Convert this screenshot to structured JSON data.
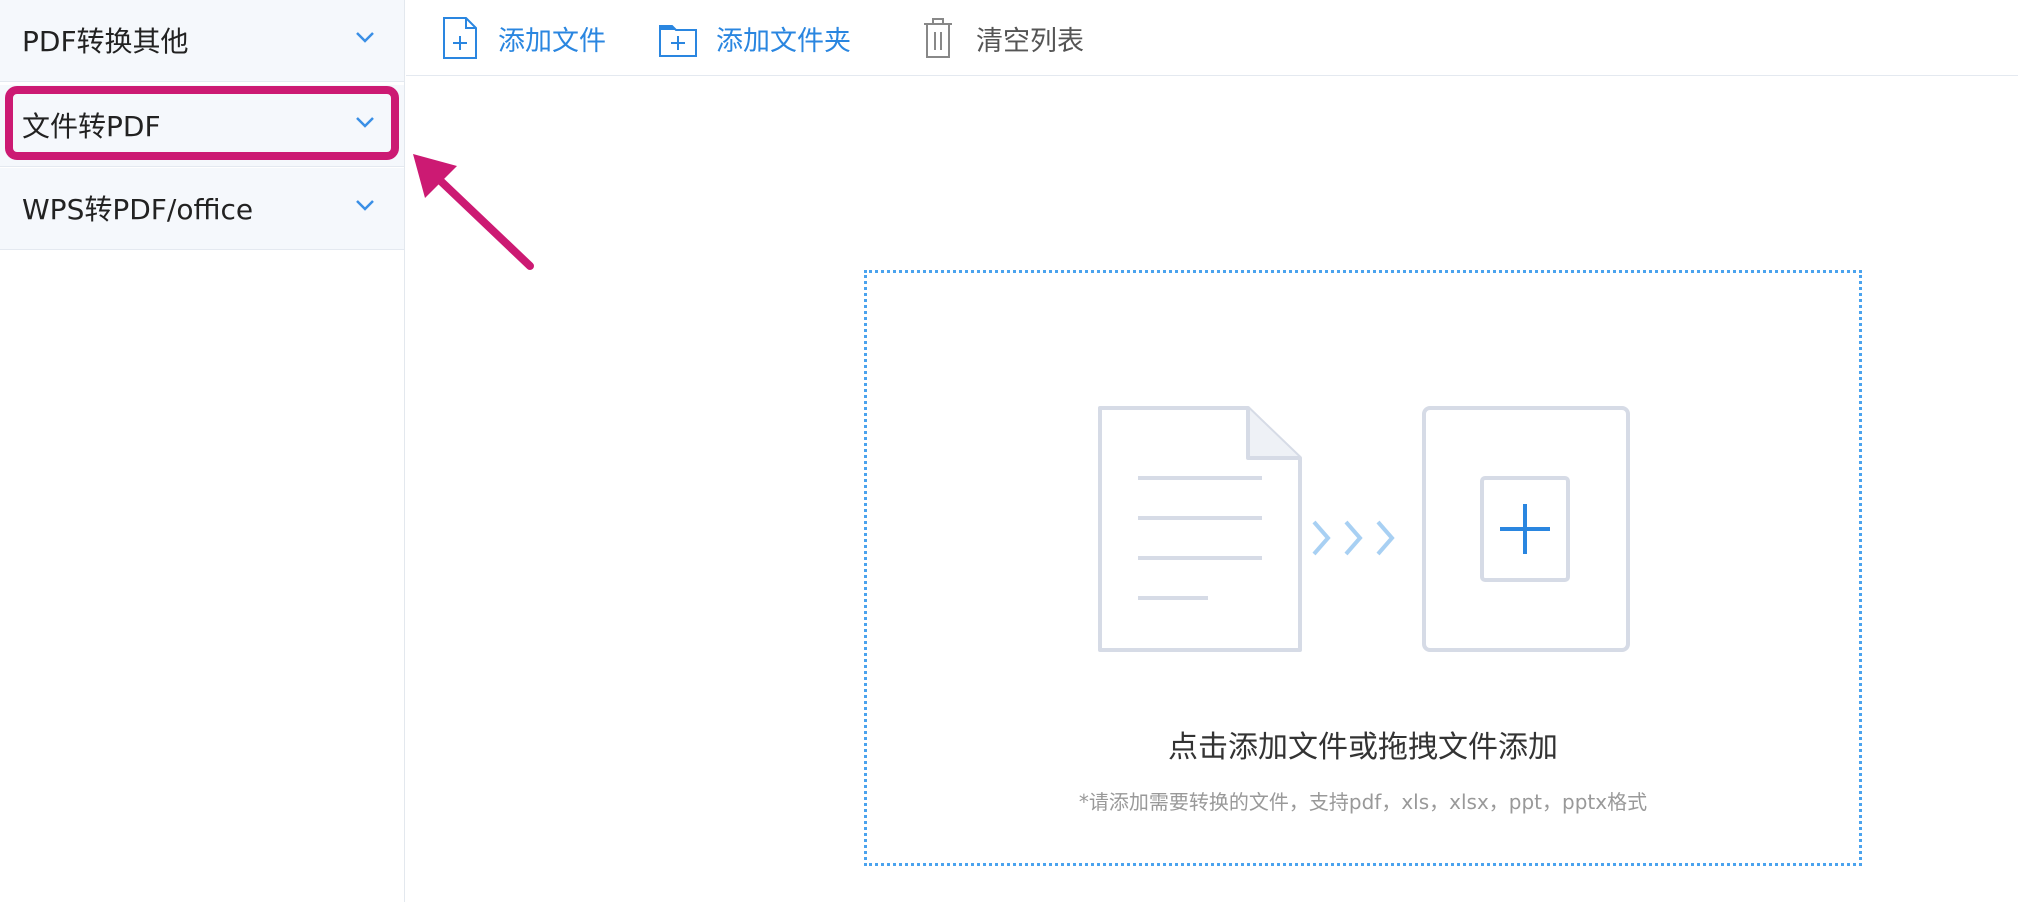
{
  "sidebar": {
    "items": [
      {
        "label": "PDF转换其他"
      },
      {
        "label": "文件转PDF"
      },
      {
        "label": "WPS转PDF/office"
      }
    ]
  },
  "toolbar": {
    "add_file_label": "添加文件",
    "add_folder_label": "添加文件夹",
    "clear_list_label": "清空列表"
  },
  "dropzone": {
    "main_text": "点击添加文件或拖拽文件添加",
    "hint_text": "*请添加需要转换的文件，支持pdf，xls，xlsx，ppt，pptx格式"
  },
  "colors": {
    "accent": "#2a86e0",
    "highlight": "#cc1a73",
    "sidebar_bg": "#f5f8fc"
  },
  "icons": [
    "chevron-down-icon",
    "add-file-icon",
    "add-folder-icon",
    "trash-icon",
    "document-icon",
    "chevrons-right-icon",
    "plus-icon",
    "arrow-annotation-icon"
  ]
}
